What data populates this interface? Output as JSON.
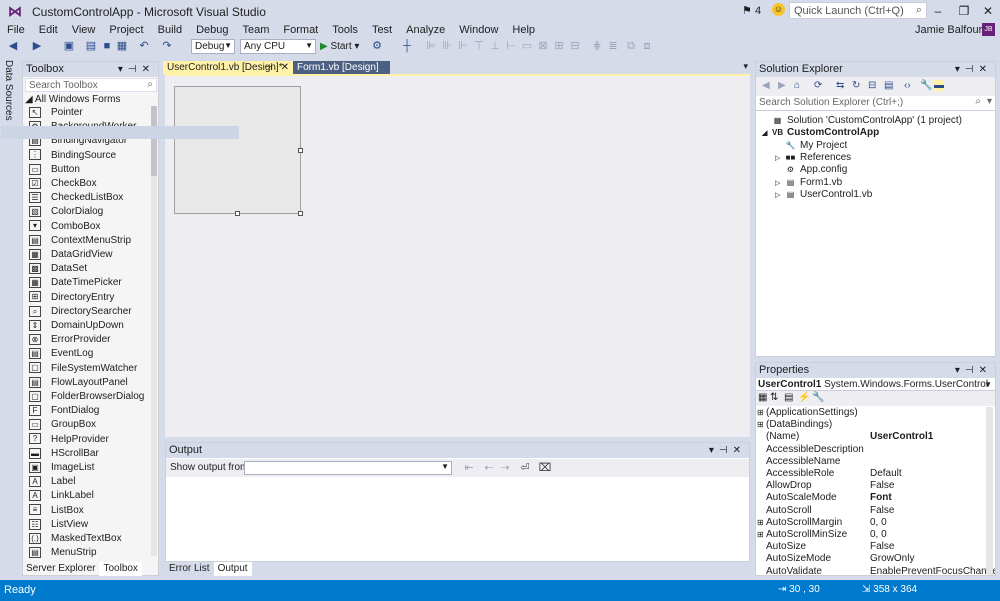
{
  "window": {
    "title": "CustomControlApp - Microsoft Visual Studio",
    "notification_count": "4",
    "quick_launch_placeholder": "Quick Launch (Ctrl+Q)",
    "user": "Jamie Balfour",
    "user_initials": "JB"
  },
  "menu": [
    "File",
    "Edit",
    "View",
    "Project",
    "Build",
    "Debug",
    "Team",
    "Format",
    "Tools",
    "Test",
    "Analyze",
    "Window",
    "Help"
  ],
  "toolbar": {
    "config": "Debug",
    "platform": "Any CPU",
    "start_label": "Start"
  },
  "left_strip": {
    "label": "Data Sources"
  },
  "toolbox": {
    "title": "Toolbox",
    "search_placeholder": "Search Toolbox",
    "group": "All Windows Forms",
    "items": [
      "Pointer",
      "BackgroundWorker",
      "BindingNavigator",
      "BindingSource",
      "Button",
      "CheckBox",
      "CheckedListBox",
      "ColorDialog",
      "ComboBox",
      "ContextMenuStrip",
      "DataGridView",
      "DataSet",
      "DateTimePicker",
      "DirectoryEntry",
      "DirectorySearcher",
      "DomainUpDown",
      "ErrorProvider",
      "EventLog",
      "FileSystemWatcher",
      "FlowLayoutPanel",
      "FolderBrowserDialog",
      "FontDialog",
      "GroupBox",
      "HelpProvider",
      "HScrollBar",
      "ImageList",
      "Label",
      "LinkLabel",
      "ListBox",
      "ListView",
      "MaskedTextBox",
      "MenuStrip"
    ],
    "tabs": [
      "Server Explorer",
      "Toolbox"
    ]
  },
  "editor": {
    "tabs": [
      "UserControl1.vb [Design]*",
      "Form1.vb [Design]"
    ]
  },
  "output": {
    "title": "Output",
    "show_from_label": "Show output from:",
    "tabs": [
      "Error List",
      "Output"
    ]
  },
  "solution_explorer": {
    "title": "Solution Explorer",
    "search_placeholder": "Search Solution Explorer (Ctrl+;)",
    "tree": [
      {
        "label": "Solution 'CustomControlApp' (1 project)"
      },
      {
        "label": "CustomControlApp"
      },
      {
        "label": "My Project"
      },
      {
        "label": "References"
      },
      {
        "label": "App.config"
      },
      {
        "label": "Form1.vb"
      },
      {
        "label": "UserControl1.vb"
      }
    ]
  },
  "properties": {
    "title": "Properties",
    "object": "UserControl1",
    "object_type": "System.Windows.Forms.UserControl",
    "rows": [
      {
        "name": "(ApplicationSettings)",
        "value": ""
      },
      {
        "name": "(DataBindings)",
        "value": ""
      },
      {
        "name": "(Name)",
        "value": "UserControl1"
      },
      {
        "name": "AccessibleDescription",
        "value": ""
      },
      {
        "name": "AccessibleName",
        "value": ""
      },
      {
        "name": "AccessibleRole",
        "value": "Default"
      },
      {
        "name": "AllowDrop",
        "value": "False"
      },
      {
        "name": "AutoScaleMode",
        "value": "Font"
      },
      {
        "name": "AutoScroll",
        "value": "False"
      },
      {
        "name": "AutoScrollMargin",
        "value": "0, 0"
      },
      {
        "name": "AutoScrollMinSize",
        "value": "0, 0"
      },
      {
        "name": "AutoSize",
        "value": "False"
      },
      {
        "name": "AutoSizeMode",
        "value": "GrowOnly"
      },
      {
        "name": "AutoValidate",
        "value": "EnablePreventFocusChange"
      }
    ]
  },
  "status": {
    "text": "Ready",
    "position": "30 , 30",
    "size": "358 x 364"
  },
  "colors": {
    "accent": "#007acc",
    "panel_header": "#4d6082",
    "active_tab": "#fff1a8"
  }
}
